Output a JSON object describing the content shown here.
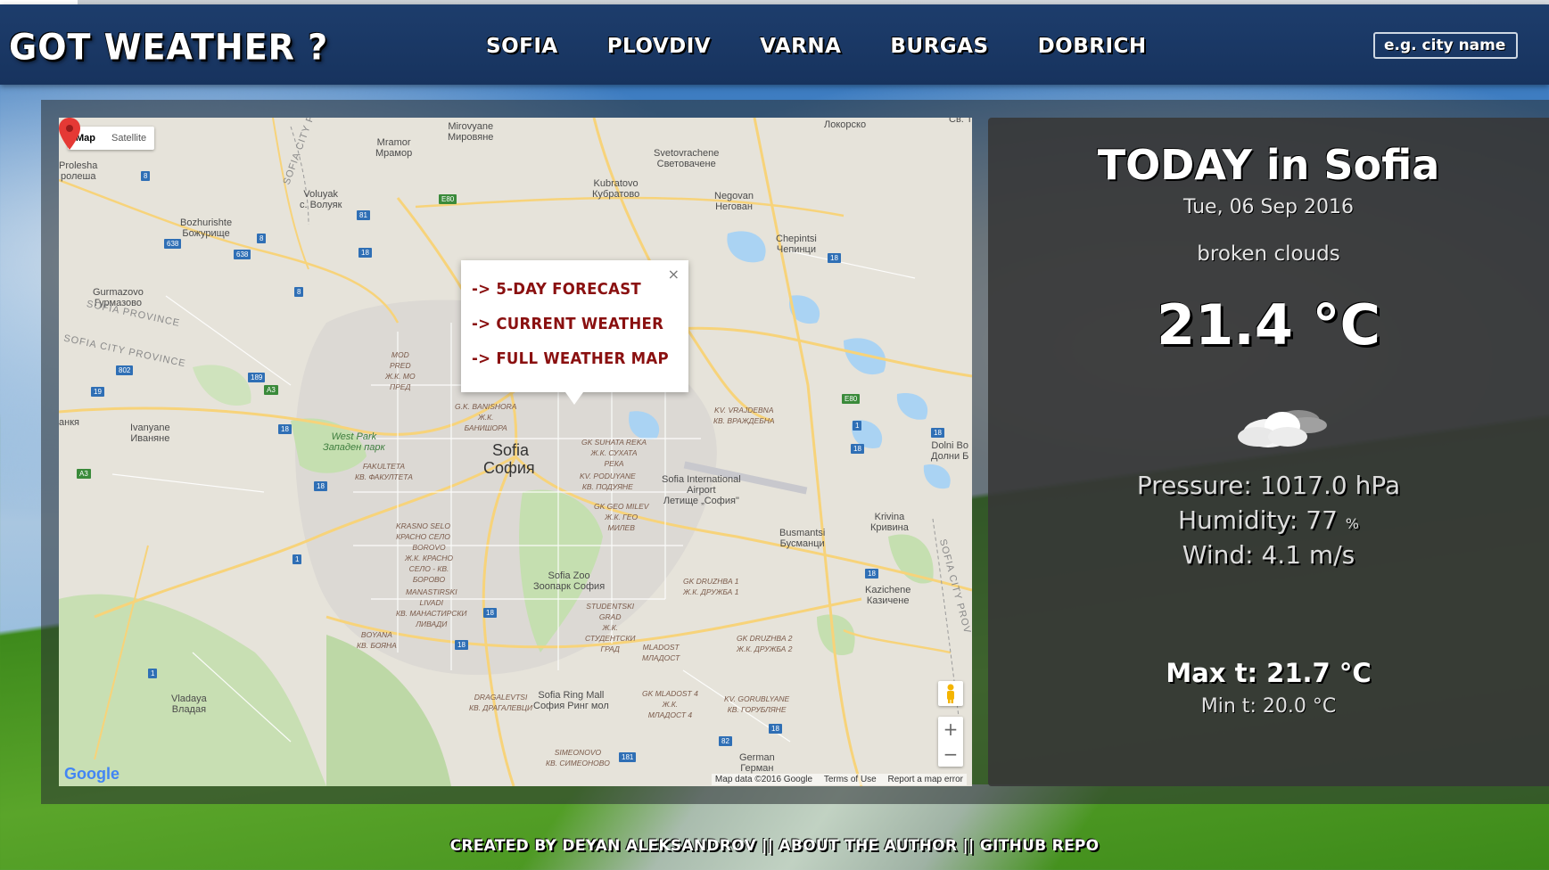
{
  "header": {
    "logo": "GOT WEATHER ?",
    "nav": [
      "SOFIA",
      "PLOVDIV",
      "VARNA",
      "BURGAS",
      "DOBRICH"
    ],
    "search_placeholder": "e.g. city name"
  },
  "map": {
    "type_buttons": [
      "Map",
      "Satellite"
    ],
    "active_type": "Map",
    "popup_links": [
      "-> 5-DAY FORECAST",
      "-> CURRENT WEATHER",
      "-> FULL WEATHER MAP"
    ],
    "popup_close": "×",
    "city_label": "Sofia",
    "city_label_cyr": "София",
    "labels": {
      "mirovyane": "Mirovyane\nМировяне",
      "mramor": "Mramor\nМрамор",
      "svetovrachene": "Svetovrachene\nСветовачене",
      "lokorsko": "Локорско",
      "kubratovo": "Kubratovo\nКубратово",
      "negovan": "Negovan\nНегован",
      "proleshaa": "Prolesha\nролеша",
      "voluyak": "Voluyak\nс. Волуяк",
      "bozhurishte": "Bozhurishte\nБожурище",
      "chepintsi": "Chepintsi\nЧепинци",
      "gurmazovo": "Gurmazovo\nГурмазово",
      "ivanyane": "Ivanyane\nИваняне",
      "bankya": "анкя",
      "westpark": "West Park\nЗападен парк",
      "fakulteta": "FAKULTETA\nКВ. ФАКУЛТЕТА",
      "krasnoselo": "KRASNO SELO\nКРАСНО СЕЛО",
      "borovo": "BOROVO\nЖ.К. КРАСНО\nСЕЛО - КВ.\nБОРОВО",
      "manastirski": "MANASTIRSKI\nLIVADI\nКВ. МАНАСТИРСКИ\nЛИВАДИ",
      "boyana": "BOYANA\nКВ. БОЯНА",
      "vladaya": "Vladaya\nВладая",
      "sofiazoo": "Sofia Zoo\nЗоопарк София",
      "studentski": "STUDENTSKI\nGRAD\nЖ.К.\nСТУДЕНТСКИ\nГРАД",
      "mladost": "MLADOST\nМЛАДОСТ",
      "mladost4": "GK MLADOST 4\nЖ.К.\nМЛАДОСТ 4",
      "dragalevtsi": "DRAGALEVTSI\nКВ. ДРАГАЛЕВЦИ",
      "sofiaringmall": "Sofia Ring Mall\nСофия Ринг мол",
      "simeonovo": "SIMEONOVO\nКВ. СИМЕОНОВО",
      "german": "German\nГерман",
      "gorubliane": "KV. GORUBLYANE\nКВ. ГОРУБЛЯНЕ",
      "druzhba1": "GK DRUZHBA 1\nЖ.К. ДРУЖБА 1",
      "druzhba2": "GK DRUZHBA 2\nЖ.К. ДРУЖБА 2",
      "sofiaairport": "Sofia International\nAirport\nЛетище „София\"",
      "busmantsi": "Busmantsi\nБусманци",
      "krivina": "Krivina\nКривина",
      "kazichene": "Kazichene\nКазичене",
      "dolnibo": "Dolni Bo\nДолни Б",
      "poduyane": "KV. PODUYANE\nКВ. ПОДУЯНЕ",
      "suhatareka": "GK SUHATA REKA\nЖ.К. СУХАТА\nРЕКА",
      "geomilev": "GK GEO MILEV\nЖ.К. ГЕО\nМИЛЕВ",
      "vrajdebna": "KV. VRAJDEBNA\nКВ. ВРАЖДЕБНА",
      "banishora": "G.K. BANISHORA\nЖ.К.\nБАНИШОРА",
      "sofiaprovince": "SOFIA PROVINCE",
      "sofiacityprovince": "SOFIA CITY PROVINCE",
      "modpred": "MOD\nPRED\nЖ.К. МО\nПРЕД",
      "sv": "Св. Т",
      "sofiacityp": "SOFIA CITY P",
      "sofiacityprov": "SOFIA CITY PROV"
    },
    "road_badges": [
      "8",
      "638",
      "81",
      "8",
      "638",
      "18",
      "8",
      "802",
      "189",
      "A3",
      "19",
      "18",
      "A3",
      "18",
      "1",
      "18",
      "1",
      "18",
      "181",
      "82",
      "18",
      "18",
      "1",
      "18",
      "E80",
      "E80",
      "18",
      "18"
    ],
    "attribution": "Map data ©2016 Google",
    "terms": "Terms of Use",
    "report": "Report a map error",
    "google_logo": "Google",
    "zoom_in": "+",
    "zoom_out": "−"
  },
  "weather": {
    "title": "TODAY in Sofia",
    "date": "Tue, 06 Sep 2016",
    "description": "broken clouds",
    "temp": "21.4",
    "temp_unit": "°C",
    "icon": "broken-clouds-icon",
    "pressure": "Pressure: 1017.0 hPa",
    "humidity_label": "Humidity: 77",
    "humidity_unit": "%",
    "wind": "Wind: 4.1 m/s",
    "max_label": "Max t: 21.7",
    "max_unit": "°C",
    "min_label": "Min t: 20.0",
    "min_unit": "°C"
  },
  "footer": {
    "created_by": "CREATED BY DEYAN ALEKSANDROV",
    "sep": " || ",
    "about": "ABOUT THE AUTHOR",
    "github": "GITHUB REPO"
  },
  "colors": {
    "header_bg": "#1d3d6c",
    "popup_link": "#8a1010",
    "panel_bg": "#373737"
  }
}
